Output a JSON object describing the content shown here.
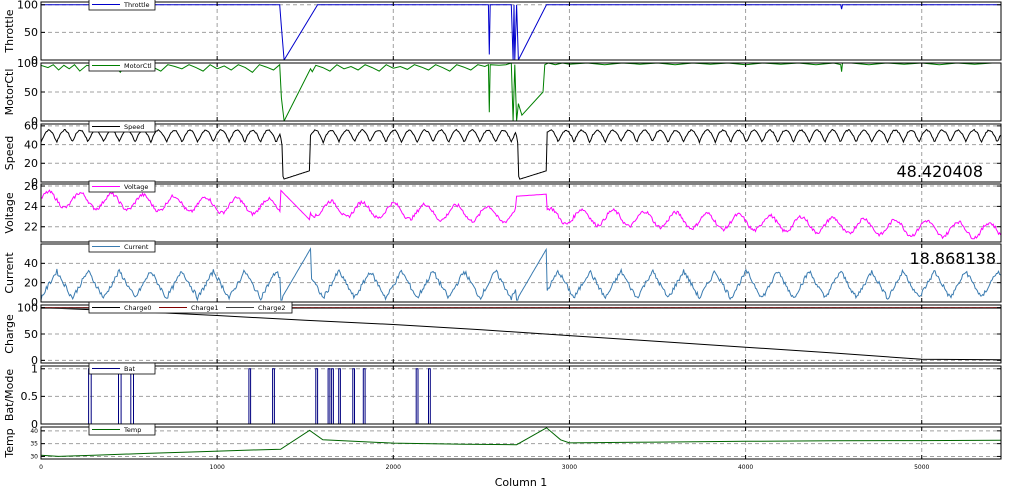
{
  "chart_data": {
    "type": "line",
    "xlabel": "Column 1",
    "xlim": [
      0,
      5450
    ],
    "xticks": [
      0,
      1000,
      2000,
      3000,
      4000,
      5000
    ],
    "panels": [
      {
        "ylabel": "Throttle",
        "ylim": [
          0,
          105
        ],
        "yticks": [
          0,
          50,
          100
        ],
        "legend": [
          "Throttle"
        ],
        "colors": [
          "#0000cc"
        ],
        "series": [
          {
            "name": "Throttle",
            "x": [
              0,
              1355,
              1365,
              1380,
              1570,
              2540,
              2545,
              2550,
              2560,
              2580,
              2590,
              2595,
              2600,
              2620,
              2640,
              2660,
              2670,
              2680,
              2685,
              2690,
              2700,
              2710,
              2870,
              4540,
              4545,
              4550,
              5450
            ],
            "y": [
              100,
              100,
              60,
              0,
              100,
              100,
              10,
              100,
              100,
              100,
              100,
              100,
              100,
              100,
              100,
              100,
              100,
              0,
              100,
              0,
              100,
              0,
              100,
              100,
              92,
              100,
              100
            ]
          }
        ]
      },
      {
        "ylabel": "MotorCtl",
        "ylim": [
          0,
          100
        ],
        "yticks": [
          0,
          50,
          100
        ],
        "legend": [
          "MotorCtl"
        ],
        "colors": [
          "#008000"
        ],
        "series": [
          {
            "name": "MotorCtl",
            "x": [
              0,
              40,
              70,
              100,
              130,
              160,
              190,
              220,
              260,
              300,
              340,
              380,
              420,
              450,
              480,
              520,
              560,
              600,
              640,
              680,
              720,
              760,
              800,
              840,
              880,
              920,
              960,
              1000,
              1040,
              1080,
              1120,
              1160,
              1200,
              1240,
              1280,
              1320,
              1355,
              1365,
              1380,
              1530,
              1540,
              1560,
              1600,
              1640,
              1680,
              1720,
              1760,
              1800,
              1840,
              1880,
              1920,
              1960,
              2000,
              2040,
              2080,
              2120,
              2160,
              2200,
              2240,
              2280,
              2320,
              2360,
              2400,
              2440,
              2480,
              2520,
              2540,
              2545,
              2550,
              2600,
              2640,
              2670,
              2680,
              2690,
              2700,
              2710,
              2720,
              2730,
              2850,
              2860,
              2880,
              2920,
              2960,
              3000,
              3100,
              3200,
              3300,
              3400,
              3500,
              3600,
              3700,
              3800,
              3900,
              4000,
              4100,
              4200,
              4300,
              4400,
              4500,
              4540,
              4545,
              4550,
              4600,
              4700,
              4800,
              4900,
              5000,
              5100,
              5200,
              5300,
              5400,
              5450
            ],
            "y": [
              96,
              92,
              97,
              88,
              96,
              90,
              97,
              86,
              96,
              93,
              97,
              90,
              96,
              84,
              97,
              94,
              88,
              97,
              92,
              86,
              97,
              94,
              90,
              97,
              92,
              86,
              97,
              90,
              95,
              88,
              97,
              92,
              84,
              97,
              93,
              88,
              97,
              40,
              0,
              90,
              85,
              96,
              92,
              86,
              97,
              90,
              94,
              88,
              97,
              92,
              86,
              97,
              91,
              94,
              89,
              97,
              93,
              88,
              97,
              92,
              86,
              97,
              93,
              88,
              97,
              94,
              97,
              15,
              97,
              96,
              97,
              100,
              0,
              97,
              0,
              30,
              20,
              10,
              50,
              97,
              100,
              97,
              100,
              98,
              100,
              97,
              100,
              98,
              100,
              97,
              100,
              98,
              100,
              97,
              100,
              98,
              100,
              97,
              100,
              97,
              85,
              100,
              100,
              97,
              100,
              98,
              100,
              97,
              100,
              98,
              100,
              100
            ]
          }
        ]
      },
      {
        "ylabel": "Speed",
        "ylim": [
          0,
          62
        ],
        "yticks": [
          0,
          20,
          40,
          60
        ],
        "legend": [
          "Speed"
        ],
        "colors": [
          "#000000"
        ],
        "readout": "48.420408",
        "series": [
          {
            "name": "Speed",
            "period": 178,
            "mean": 49,
            "amplitude": 8,
            "gaps": [
              [
                1360,
                1525
              ],
              [
                2700,
                2870
              ]
            ],
            "gap_floor": 2,
            "gap_mid": 10
          }
        ]
      },
      {
        "ylabel": "Voltage",
        "ylim": [
          20.5,
          26.2
        ],
        "yticks": [
          22,
          24,
          26
        ],
        "legend": [
          "Voltage"
        ],
        "colors": [
          "#ff00ff"
        ],
        "series": [
          {
            "name": "Voltage",
            "period": 178,
            "start": 24.7,
            "end": 21.6,
            "amplitude": 0.75,
            "jumps": [
              [
                1360,
                25.6
              ],
              [
                1530,
                22.6
              ],
              [
                2700,
                25.2
              ],
              [
                2870,
                21.8
              ]
            ]
          }
        ]
      },
      {
        "ylabel": "Current",
        "ylim": [
          0,
          60
        ],
        "yticks": [
          0,
          20,
          40
        ],
        "legend": [
          "Current"
        ],
        "colors": [
          "#3a7bb0"
        ],
        "readout": "18.868138",
        "series": [
          {
            "name": "Current",
            "period": 178,
            "mean": 18,
            "amplitude": 14,
            "gaps": [
              [
                1360,
                1530
              ],
              [
                2700,
                2870
              ]
            ],
            "peak": 55
          }
        ]
      },
      {
        "ylabel": "Charge",
        "ylim": [
          -5,
          105
        ],
        "yticks": [
          0,
          50,
          100
        ],
        "legend": [
          "Charge0",
          "Charge1",
          "Charge2"
        ],
        "colors": [
          "#000000",
          "#800000",
          "#404040"
        ],
        "series": [
          {
            "name": "Charge0",
            "x": [
              0,
              500,
              1000,
              1500,
              2000,
              2500,
              3000,
              3500,
              4000,
              4500,
              5000,
              5450
            ],
            "y": [
              100,
              93,
              85,
              76,
              68,
              58,
              47,
              36,
              25,
              14,
              2,
              1
            ]
          },
          {
            "name": "Charge1",
            "x": [
              0,
              5450
            ],
            "y": [
              100,
              100
            ]
          },
          {
            "name": "Charge2",
            "x": [
              0,
              5450
            ],
            "y": [
              99,
              99
            ]
          }
        ]
      },
      {
        "ylabel": "Bat/Mode",
        "ylim": [
          0,
          1.05
        ],
        "yticks": [
          0,
          0.5,
          1
        ],
        "legend": [
          "Bat"
        ],
        "colors": [
          "#000080"
        ],
        "series": [
          {
            "name": "Bat",
            "pulses": [
              [
                270,
                285
              ],
              [
                440,
                455
              ],
              [
                510,
                525
              ],
              [
                1180,
                1190
              ],
              [
                1315,
                1325
              ],
              [
                1560,
                1570
              ],
              [
                1630,
                1640
              ],
              [
                1650,
                1660
              ],
              [
                1690,
                1700
              ],
              [
                1770,
                1780
              ],
              [
                1830,
                1840
              ],
              [
                2130,
                2140
              ],
              [
                2200,
                2210
              ]
            ]
          }
        ]
      },
      {
        "ylabel": "Temp",
        "ylim": [
          29,
          41.5
        ],
        "yticks": [
          30,
          35,
          40
        ],
        "legend": [
          "Temp"
        ],
        "colors": [
          "#006400"
        ],
        "series": [
          {
            "name": "Temp",
            "x": [
              0,
              100,
              300,
              600,
              900,
              1200,
              1360,
              1525,
              1600,
              2000,
              2400,
              2700,
              2870,
              2950,
              3000,
              3500,
              4000,
              4500,
              5000,
              5450
            ],
            "y": [
              30.5,
              30,
              30.5,
              31.2,
              31.8,
              32.5,
              32.8,
              40.2,
              36.5,
              35.2,
              34.8,
              34.6,
              41.2,
              36.5,
              35.3,
              35.6,
              35.9,
              36.1,
              36.2,
              36.3
            ]
          }
        ]
      }
    ]
  }
}
